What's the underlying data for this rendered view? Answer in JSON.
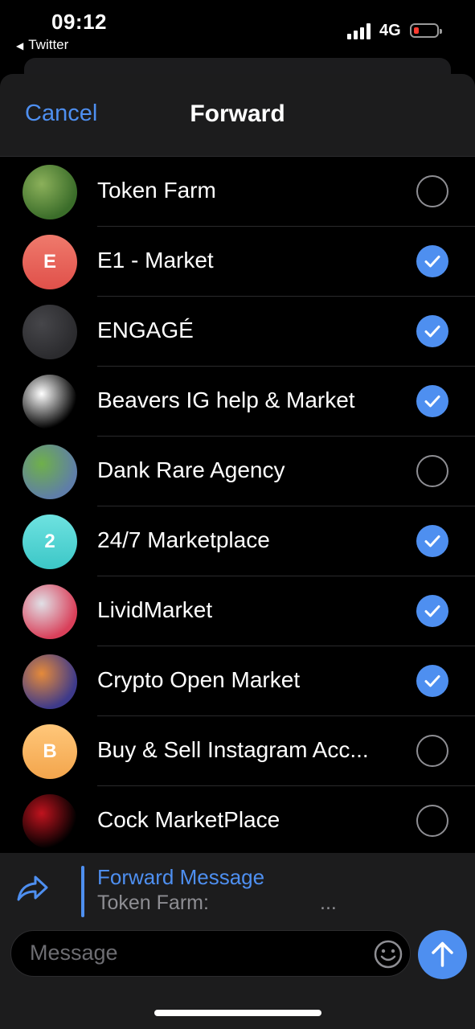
{
  "status_bar": {
    "time": "09:12",
    "back_app": "Twitter",
    "network": "4G",
    "battery_color": "#ff3b30"
  },
  "nav": {
    "cancel_label": "Cancel",
    "title": "Forward"
  },
  "chats": [
    {
      "name": "Token Farm",
      "selected": false,
      "avatar": "image",
      "avatar_colors": [
        "#3b6d2a",
        "#8bb05a"
      ]
    },
    {
      "name": "E1 - Market",
      "selected": true,
      "avatar": "letter",
      "letter": "E",
      "avatar_colors": [
        "#ef7a6c",
        "#e0504a"
      ]
    },
    {
      "name": "ENGAGÉ",
      "selected": true,
      "avatar": "image",
      "avatar_colors": [
        "#2b2b2e",
        "#46464a"
      ]
    },
    {
      "name": "Beavers IG help & Market",
      "selected": true,
      "avatar": "image",
      "avatar_colors": [
        "#000000",
        "#ffffff"
      ]
    },
    {
      "name": "Dank Rare Agency",
      "selected": false,
      "avatar": "image",
      "avatar_colors": [
        "#5f7ea8",
        "#6fb04a"
      ]
    },
    {
      "name": "24/7 Marketplace",
      "selected": true,
      "avatar": "letter",
      "letter": "2",
      "avatar_colors": [
        "#6ee2e0",
        "#3cc7c7"
      ]
    },
    {
      "name": "LividMarket",
      "selected": true,
      "avatar": "image",
      "avatar_colors": [
        "#d9405a",
        "#e0e0e6"
      ]
    },
    {
      "name": "Crypto Open Market",
      "selected": true,
      "avatar": "image",
      "avatar_colors": [
        "#3e3a8a",
        "#e58a3a"
      ]
    },
    {
      "name": "Buy & Sell Instagram Acc...",
      "selected": false,
      "avatar": "letter",
      "letter": "B",
      "avatar_colors": [
        "#ffc77a",
        "#f3a54c"
      ]
    },
    {
      "name": "Cock MarketPlace",
      "selected": false,
      "avatar": "image",
      "avatar_colors": [
        "#000000",
        "#c0131e"
      ]
    }
  ],
  "forward_preview": {
    "title": "Forward Message",
    "subtitle": "Token Farm:",
    "ellipsis": "..."
  },
  "composer": {
    "placeholder": "Message"
  },
  "colors": {
    "accent": "#4e8ff0",
    "background": "#000000",
    "panel": "#1c1c1d"
  },
  "icons": [
    "forward-arrow-icon",
    "emoji-icon",
    "send-arrow-icon",
    "checkmark-icon",
    "signal-icon",
    "battery-icon"
  ]
}
